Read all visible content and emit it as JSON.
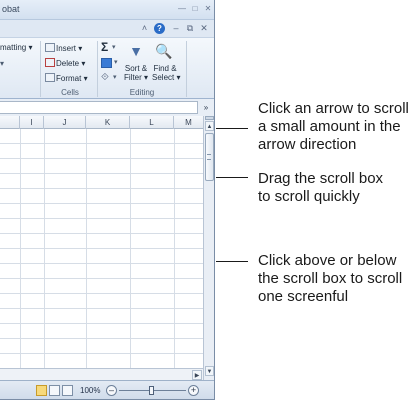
{
  "window": {
    "title_fragment": "obat"
  },
  "ribbon": {
    "formatting_label": "matting",
    "insert_label": "Insert",
    "delete_label": "Delete",
    "format_label": "Format",
    "sort_filter_line1": "Sort &",
    "sort_filter_line2": "Filter",
    "find_select_line1": "Find &",
    "find_select_line2": "Select",
    "group_cells": "Cells",
    "group_editing": "Editing"
  },
  "sheet": {
    "columns": [
      "I",
      "J",
      "K",
      "L",
      "M"
    ]
  },
  "status_bar": {
    "zoom_label": "100%",
    "zoom_level": 1.0
  },
  "callouts": {
    "arrow": [
      "Click an arrow to scroll",
      "a small amount in the",
      "arrow direction"
    ],
    "scroll_box": [
      "Drag the scroll box",
      "to scroll quickly"
    ],
    "screenful": [
      "Click above or below",
      "the scroll box to scroll",
      "one screenful"
    ]
  },
  "colors": {
    "ribbon_bg": "#dfe8f3",
    "help_icon": "#2a6cc7",
    "grid_line": "#d6dde6",
    "active_view": "#f7d97a"
  },
  "icons": [
    "help-icon",
    "minimize-icon",
    "restore-icon",
    "close-icon",
    "sum-icon",
    "fill-icon",
    "clear-icon",
    "sort-filter-icon",
    "find-select-icon",
    "expand-formula-icon",
    "scroll-up-icon",
    "scroll-down-icon",
    "scroll-right-icon",
    "zoom-out-icon",
    "zoom-in-icon"
  ]
}
